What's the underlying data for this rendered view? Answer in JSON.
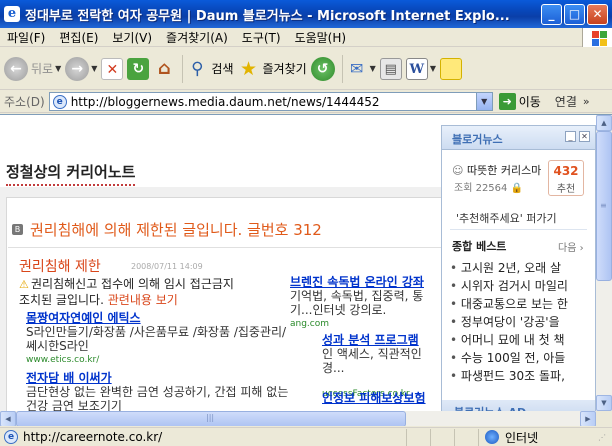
{
  "window": {
    "title": "정대부로 전락한 여자 공무원 | Daum 블로거뉴스 - Microsoft Internet Explo...",
    "icon_glyph": "e",
    "minimize_glyph": "_",
    "restore_glyph": "□",
    "close_glyph": "✕"
  },
  "menu": [
    "파일(F)",
    "편집(E)",
    "보기(V)",
    "즐겨찾기(A)",
    "도구(T)",
    "도움말(H)"
  ],
  "toolbar": {
    "back_label": "뒤로",
    "search_label": "검색",
    "favorites_label": "즐겨찾기"
  },
  "address": {
    "label": "주소(D)",
    "url": "http://bloggernews.media.daum.net/news/1444452",
    "go_label": "이동",
    "links_label": "연결"
  },
  "page": {
    "blog_title": "정철상의 커리어노트",
    "notice_title": "권리침해에 의해 제한된 글입니다. 글번호 312",
    "sub_title": "권리침해 제한",
    "date": "2008/07/11 14:09",
    "desc_line1": "권리침해신고 접수에 의해 임시 접근금지",
    "desc_line2": "조치된 글입니다.",
    "related": "관련내용 보기"
  },
  "ads": [
    {
      "title": "몸짱여자연예인 에틱스",
      "body": "S라인만들기/화장품 /사은품무료 /화장품 /집중관리/쎄시한S라인",
      "url": "www.etics.co.kr/"
    },
    {
      "title": "전자담 배 이써가",
      "body": "금단현상 없는 완벽한 금연 성공하기, 간접 피해 없는 건강 금연 보조기기",
      "url": ""
    },
    {
      "title": "브렌진 속독법 온라인 강좌",
      "body": "기억법, 속독법, 집중력, 통기...인터넷 강의로.",
      "url": "ang.com"
    },
    {
      "title": "성과 분석 프로그램",
      "body": "인 액세스, 직관적인 경...",
      "url": "uccessFactors.co.kr"
    },
    {
      "title": "인정보 피해보상보험",
      "body": "",
      "url": ""
    }
  ],
  "widget": {
    "title": "블로거뉴스",
    "blog_name": "따뜻한 커리스마",
    "views": "조회 22564",
    "count": "432",
    "recommend": "추천",
    "cta": "'추천해주세요' 퍼가기",
    "best_title": "종합 베스트",
    "more": "다음 ›",
    "best_list": [
      "고시원 2년, 오래 살",
      "시위자 검거시 마일리",
      "대중교통으로 보는 한",
      "정부여당이 '강공'을",
      "어머니 묘에 내 첫 책",
      "수능 100일 전, 아들",
      "파생펀드 30조 돌파,"
    ],
    "ad_label": "블로거뉴스 AD"
  },
  "status": {
    "text": "http://careernote.co.kr/",
    "zone": "인터넷"
  }
}
